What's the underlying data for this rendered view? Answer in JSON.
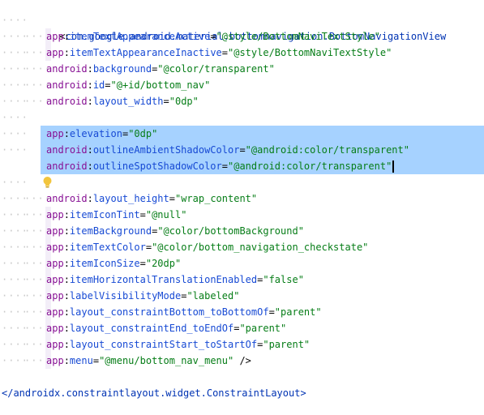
{
  "theme": {
    "background": "#ffffff",
    "selection": "#a6d2ff",
    "current_line": "#fcfaed",
    "namespace_color": "#871094",
    "attribute_color": "#174ad4",
    "value_color": "#067d17",
    "tag_color": "#0033b3",
    "bulb_color": "#f2c53d"
  },
  "editor": {
    "open_tag": {
      "bracket": "<",
      "name": "com.google.android.material.bottomnavigation.BottomNavigationView"
    },
    "attributes": [
      {
        "ns": "app",
        "name": "itemTextAppearanceActive",
        "value": "\"@style/BottomNaviTextStyle\""
      },
      {
        "ns": "app",
        "name": "itemTextAppearanceInactive",
        "value": "\"@style/BottomNaviTextStyle\""
      },
      {
        "ns": "android",
        "name": "background",
        "value": "\"@color/transparent\""
      },
      {
        "ns": "android",
        "name": "id",
        "value": "\"@+id/bottom_nav\""
      },
      {
        "ns": "android",
        "name": "layout_width",
        "value": "\"0dp\""
      },
      {
        "ns": "app",
        "name": "elevation",
        "value": "\"0dp\""
      },
      {
        "ns": "android",
        "name": "outlineAmbientShadowColor",
        "value": "\"@android:color/transparent\""
      },
      {
        "ns": "android",
        "name": "outlineSpotShadowColor",
        "value": "\"@android:color/transparent\""
      },
      {
        "ns": "android",
        "name": "layout_height",
        "value": "\"wrap_content\""
      },
      {
        "ns": "app",
        "name": "itemIconTint",
        "value": "\"@null\""
      },
      {
        "ns": "app",
        "name": "itemBackground",
        "value": "\"@color/bottomBackground\""
      },
      {
        "ns": "app",
        "name": "itemTextColor",
        "value": "\"@color/bottom_navigation_checkstate\""
      },
      {
        "ns": "app",
        "name": "itemIconSize",
        "value": "\"20dp\""
      },
      {
        "ns": "app",
        "name": "itemHorizontalTranslationEnabled",
        "value": "\"false\""
      },
      {
        "ns": "app",
        "name": "labelVisibilityMode",
        "value": "\"labeled\""
      },
      {
        "ns": "app",
        "name": "layout_constraintBottom_toBottomOf",
        "value": "\"parent\""
      },
      {
        "ns": "app",
        "name": "layout_constraintEnd_toEndOf",
        "value": "\"parent\""
      },
      {
        "ns": "app",
        "name": "layout_constraintStart_toStartOf",
        "value": "\"parent\""
      },
      {
        "ns": "app",
        "name": "menu",
        "value": "\"@menu/bottom_nav_menu\"",
        "suffix": " />"
      }
    ],
    "close_tag": "</androidx.constraintlayout.widget.ConstraintLayout>",
    "whitespace_dots": "····",
    "colon": ":",
    "equals": "="
  }
}
